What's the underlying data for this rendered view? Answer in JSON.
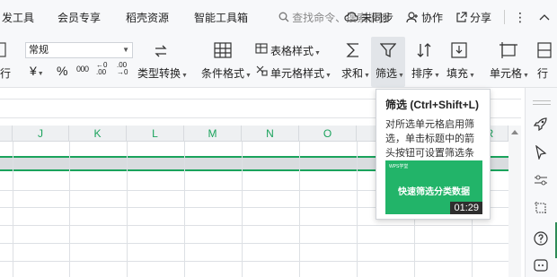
{
  "menubar": {
    "items": [
      "发工具",
      "会员专享",
      "稻壳资源",
      "智能工具箱"
    ],
    "search_placeholder": "查找命令、搜索模板",
    "sync_label": "未同步",
    "collab_label": "协作",
    "share_label": "分享"
  },
  "ribbon": {
    "number_format_value": "常规",
    "left_cut_label": "行",
    "currency_symbol": "¥",
    "percent_symbol": "%",
    "thousand_symbol": "000",
    "inc_decimal_symbol": "←0 .00",
    "dec_decimal_symbol": ".00 →0",
    "type_convert_label": "类型转换",
    "cond_format_label": "条件格式",
    "table_style_label": "表格样式",
    "cell_style_label": "单元格样式",
    "sum_label": "求和",
    "filter_label": "筛选",
    "sort_label": "排序",
    "fill_label": "填充",
    "cell_label": "单元格",
    "row_col_label": "行"
  },
  "columns": [
    "J",
    "K",
    "L",
    "M",
    "N",
    "O",
    "R"
  ],
  "tooltip": {
    "title": "筛选 (Ctrl+Shift+L)",
    "description": "对所选单元格启用筛选，单击标题中的箭头按钮可设置筛选条件。",
    "video_title": "快速筛选分类数据",
    "video_logo": "WPS学堂",
    "video_duration": "01:29"
  },
  "colors": {
    "accent": "#1aa35c",
    "video_bg": "#22b469"
  }
}
